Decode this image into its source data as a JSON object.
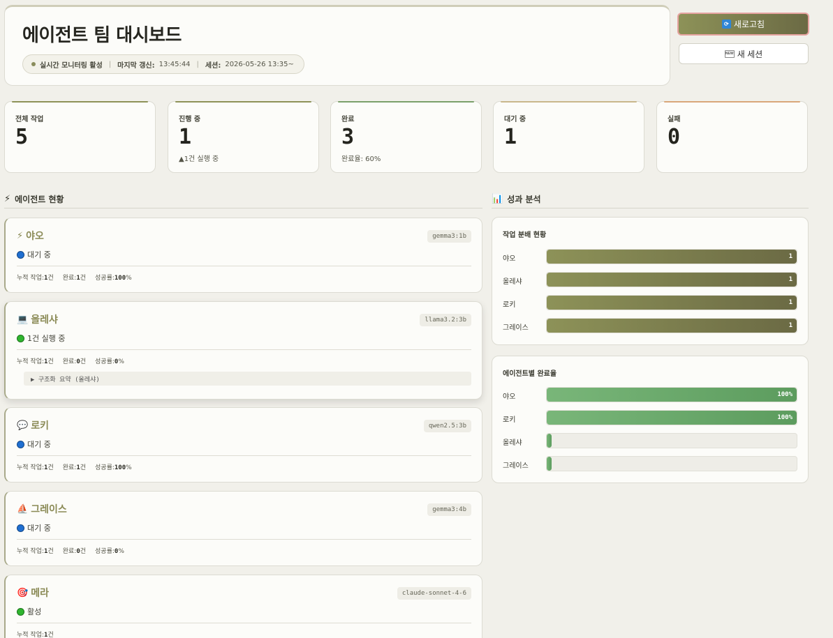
{
  "header": {
    "title": "에이전트 팀 대시보드",
    "monitoring": "실시간 모니터링 활성",
    "last_update_label": "마지막 갱신:",
    "last_update_value": "13:45:44",
    "session_label": "세션:",
    "session_value": "2026-05-26 13:35~",
    "refresh_label": "새로고침",
    "new_session_label": "새 세션"
  },
  "stats": [
    {
      "label": "전체 작업",
      "value": "5",
      "sub": "",
      "color": "#8d9258"
    },
    {
      "label": "진행 중",
      "value": "1",
      "sub": "▲1건 실행 중",
      "color": "#8d9258"
    },
    {
      "label": "완료",
      "value": "3",
      "sub": "완료율: 60%",
      "color": "#7aa06a"
    },
    {
      "label": "대기 중",
      "value": "1",
      "sub": "",
      "color": "#c9b78c"
    },
    {
      "label": "실패",
      "value": "0",
      "sub": "",
      "color": "#d9a77a"
    }
  ],
  "sections": {
    "agents": "에이전트 현황",
    "analytics": "성과 분석"
  },
  "agents": [
    {
      "icon": "⚡",
      "name": "야오",
      "model": "gemma3:1b",
      "status": "대기 중",
      "status_color": "#1f6fd1",
      "m1_label": "누적 작업:",
      "m1_value": "1",
      "m1_unit": "건",
      "m2_label": "완료:",
      "m2_value": "1",
      "m2_unit": "건",
      "m3_label": "성공률:",
      "m3_value": "100",
      "m3_unit": "%"
    },
    {
      "icon": "💻",
      "name": "올레샤",
      "model": "llama3.2:3b",
      "status": "1건 실행 중",
      "status_color": "#2fb52f",
      "m1_label": "누적 작업:",
      "m1_value": "1",
      "m1_unit": "건",
      "m2_label": "완료:",
      "m2_value": "0",
      "m2_unit": "건",
      "m3_label": "성공률:",
      "m3_value": "0",
      "m3_unit": "%",
      "task": "▶ 구조화 요약 (올레샤)"
    },
    {
      "icon": "💬",
      "name": "로키",
      "model": "qwen2.5:3b",
      "status": "대기 중",
      "status_color": "#1f6fd1",
      "m1_label": "누적 작업:",
      "m1_value": "1",
      "m1_unit": "건",
      "m2_label": "완료:",
      "m2_value": "1",
      "m2_unit": "건",
      "m3_label": "성공률:",
      "m3_value": "100",
      "m3_unit": "%"
    },
    {
      "icon": "⛵",
      "name": "그레이스",
      "model": "gemma3:4b",
      "status": "대기 중",
      "status_color": "#1f6fd1",
      "m1_label": "누적 작업:",
      "m1_value": "1",
      "m1_unit": "건",
      "m2_label": "완료:",
      "m2_value": "0",
      "m2_unit": "건",
      "m3_label": "성공률:",
      "m3_value": "0",
      "m3_unit": "%"
    },
    {
      "icon": "🎯",
      "name": "메라",
      "model": "claude-sonnet-4-6",
      "status": "활성",
      "status_color": "#2fb52f",
      "m1_label": "누적 작업:",
      "m1_value": "1",
      "m1_unit": "건"
    }
  ],
  "distribution": {
    "title": "작업 분배 현황",
    "max": 1,
    "rows": [
      {
        "label": "야오",
        "value": 1
      },
      {
        "label": "올레샤",
        "value": 1
      },
      {
        "label": "로키",
        "value": 1
      },
      {
        "label": "그레이스",
        "value": 1
      }
    ]
  },
  "completion": {
    "title": "에이전트별 완료율",
    "rows": [
      {
        "label": "야오",
        "value": 100,
        "text": "100%"
      },
      {
        "label": "로키",
        "value": 100,
        "text": "100%"
      },
      {
        "label": "올레샤",
        "value": 0,
        "text": ""
      },
      {
        "label": "그레이스",
        "value": 0,
        "text": ""
      }
    ]
  }
}
